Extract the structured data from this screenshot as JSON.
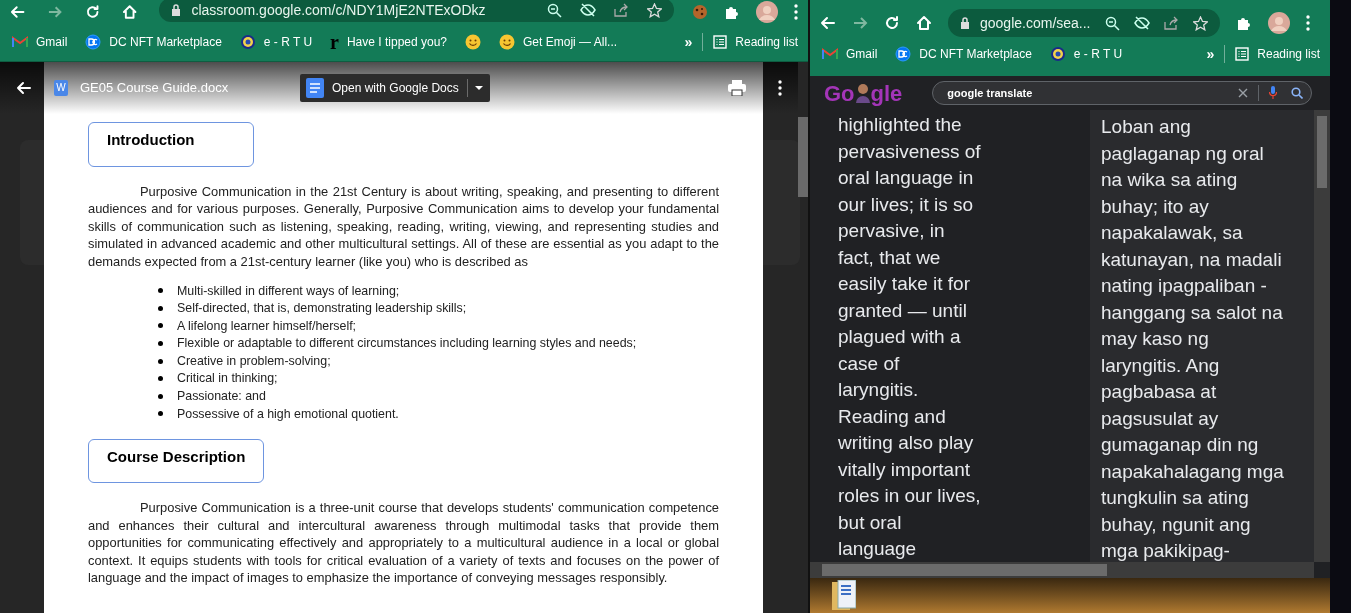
{
  "left_browser": {
    "address": "classroom.google.com/c/NDY1MjE2NTExODkz",
    "bookmarks": [
      {
        "kind": "gmail",
        "label": "Gmail"
      },
      {
        "kind": "dc",
        "label": "DC NFT Marketplace"
      },
      {
        "kind": "seal",
        "label": "e - R T U"
      },
      {
        "kind": "letter",
        "icon_text": "r",
        "label": "Have I tipped you?"
      },
      {
        "kind": "smiley"
      },
      {
        "kind": "smiley",
        "label": "Get Emoji — All..."
      }
    ],
    "more_bookmarks": "»",
    "reading_list": "Reading list",
    "viewer": {
      "file_name": "GE05 Course Guide.docx",
      "file_badge": "W",
      "open_button": "Open with Google Docs"
    },
    "document": {
      "sections": [
        {
          "heading": "Introduction",
          "paragraph": "Purposive Communication in the 21st Century is about writing, speaking, and presenting to different audiences and for various purposes. Generally, Purposive Communication aims to develop your fundamental skills of communication such as listening, speaking, reading, writing, viewing, and representing studies and simulated in advanced academic and other multicultural settings. All of these are essential as you adapt to the demands expected from a 21st-century learner (like you) who is described as",
          "bullets": [
            "Multi-skilled in different ways of learning;",
            "Self-directed, that is, demonstrating leadership skills;",
            "A lifelong learner himself/herself;",
            "Flexible or adaptable to different circumstances including learning styles and needs;",
            "Creative in problem-solving;",
            "Critical in thinking;",
            "Passionate: and",
            "Possessive of a high emotional quotient."
          ]
        },
        {
          "heading": "Course Description",
          "paragraph": "Purposive Communication is a three-unit course that develops students' communication competence and enhances their cultural and intercultural awareness through multimodal tasks that provide them opportunities for communicating effectively and appropriately to a multicultural audience in a local or global context. It equips students with tools for critical evaluation of a variety of texts and focuses on the power of language and the impact of images to emphasize the importance of conveying messages responsibly."
        }
      ]
    }
  },
  "right_browser": {
    "address": "google.com/sea...",
    "bookmarks": [
      {
        "kind": "gmail",
        "label": "Gmail"
      },
      {
        "kind": "dc",
        "label": "DC NFT Marketplace"
      },
      {
        "kind": "seal",
        "label": "e - R T U"
      }
    ],
    "more_bookmarks": "»",
    "reading_list": "Reading list",
    "logo": [
      "Go",
      "gle"
    ],
    "search_query": "google translate",
    "source_lines": [
      "highlighted the",
      "pervasiveness of",
      "oral language in",
      "our lives; it is so",
      "pervasive, in",
      "fact, that we",
      "easily take it for",
      "granted — until",
      "plagued with a",
      "case of",
      "laryngitis.",
      "Reading and",
      "writing also play",
      "vitally important",
      "roles in our lives,",
      "but oral",
      "language"
    ],
    "target_lines": [
      "Loban ang",
      "paglaganap ng oral",
      "na wika sa ating",
      "buhay; ito ay",
      "napakalawak, sa",
      "katunayan, na madali",
      "nating ipagpaliban -",
      "hanggang sa salot na",
      "may kaso ng",
      "laryngitis. Ang",
      "pagbabasa at",
      "pagsusulat ay",
      "gumaganap din ng",
      "napakahalagang mga",
      "tungkulin sa ating",
      "buhay, ngunit ang",
      "mga pakikipag-"
    ]
  }
}
